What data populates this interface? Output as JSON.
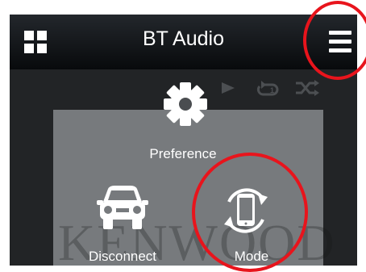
{
  "header": {
    "title": "BT Audio",
    "left_icon": "grid-icon",
    "right_icon": "hamburger-menu-icon"
  },
  "playback": {
    "icons": [
      "play-icon",
      "repeat-one-icon",
      "shuffle-icon"
    ]
  },
  "menu": {
    "preference_label": "Preference",
    "disconnect_label": "Disconnect",
    "mode_label": "Mode",
    "watermark": "KENWOOD"
  },
  "colors": {
    "header_bg": "#0b0d0f",
    "screen_bg": "#222426",
    "panel_bg": "#777a7d",
    "highlight_ring": "#e8141c",
    "text": "#ffffff"
  }
}
